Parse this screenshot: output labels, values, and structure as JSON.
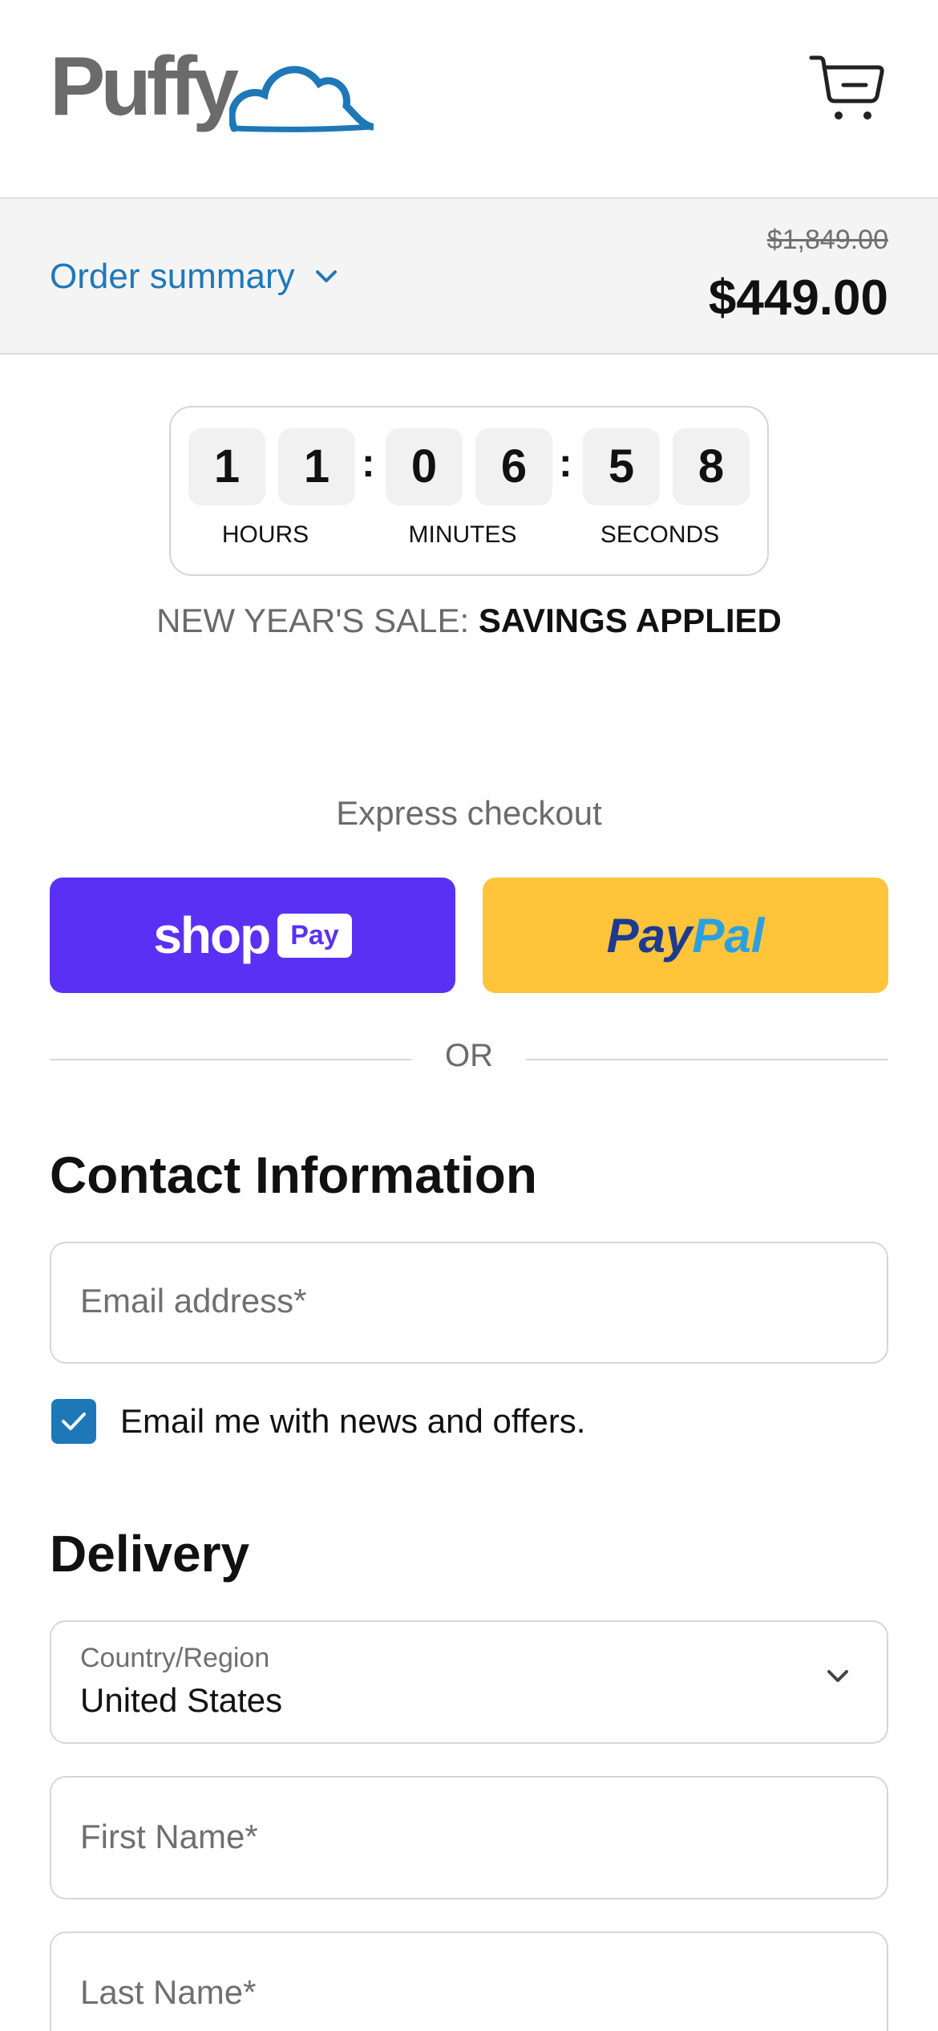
{
  "brand": {
    "name": "Puffy"
  },
  "header": {
    "cart_icon": "cart-icon"
  },
  "summary": {
    "toggle_label": "Order summary",
    "original_price": "$1,849.00",
    "total_price": "$449.00"
  },
  "countdown": {
    "hours": [
      "1",
      "1"
    ],
    "minutes": [
      "0",
      "6"
    ],
    "seconds": [
      "5",
      "8"
    ],
    "separator": ":",
    "labels": {
      "hours": "HOURS",
      "minutes": "MINUTES",
      "seconds": "SECONDS"
    }
  },
  "sale": {
    "prefix": "NEW YEAR'S SALE: ",
    "highlight": "SAVINGS APPLIED"
  },
  "express": {
    "title": "Express checkout",
    "shop_pay": {
      "word": "shop",
      "badge": "Pay"
    },
    "paypal": {
      "part1": "Pay",
      "part2": "Pal"
    },
    "divider": "OR"
  },
  "contact": {
    "heading": "Contact Information",
    "email_placeholder": "Email address*",
    "newsletter_label": "Email me with news and offers.",
    "newsletter_checked": true
  },
  "delivery": {
    "heading": "Delivery",
    "country_label": "Country/Region",
    "country_value": "United States",
    "first_name_placeholder": "First Name*",
    "last_name_placeholder": "Last Name*"
  },
  "colors": {
    "accent": "#1e78b8",
    "shop_pay": "#5a31f4",
    "paypal": "#ffc439",
    "summary_bg": "#f4f4f4"
  }
}
